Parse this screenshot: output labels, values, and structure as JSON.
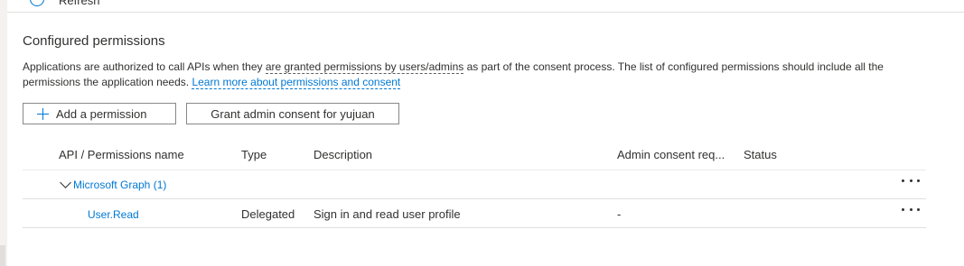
{
  "top_partial": {
    "label": "Refresh"
  },
  "section": {
    "title": "Configured permissions",
    "description_part1": "Applications are authorized to call APIs when they ",
    "description_dashed": "are granted permissions by users/admins",
    "description_part2": " as part of the consent process. The list of configured permissions should include all the permissions the application needs. ",
    "learn_more_link": "Learn more about permissions and consent"
  },
  "toolbar": {
    "add_permission_label": "Add a permission",
    "grant_consent_label": "Grant admin consent for yujuan"
  },
  "table": {
    "headers": {
      "api_name": "API / Permissions name",
      "type": "Type",
      "description": "Description",
      "admin_consent": "Admin consent req...",
      "status": "Status"
    },
    "groups": [
      {
        "name": "Microsoft Graph (1)",
        "permissions": [
          {
            "name": "User.Read",
            "type": "Delegated",
            "description": "Sign in and read user profile",
            "admin_consent": "-",
            "status": ""
          }
        ]
      }
    ]
  },
  "icons": {
    "plus": "plus-icon",
    "chevron": "chevron-down-icon",
    "more": "more-icon"
  },
  "colors": {
    "accent": "#0078d4",
    "text": "#323130",
    "border": "#8a8886"
  }
}
